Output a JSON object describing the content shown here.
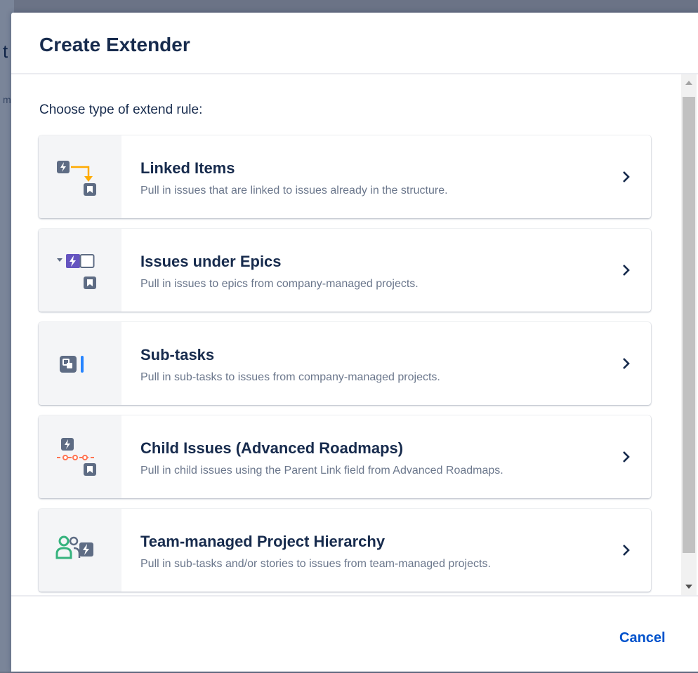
{
  "dialog": {
    "title": "Create Extender",
    "intro": "Choose type of extend rule:",
    "cancel_label": "Cancel"
  },
  "background": {
    "char_1": "t",
    "char_2": "m"
  },
  "options": [
    {
      "title": "Linked Items",
      "description": "Pull in issues that are linked to issues already in the structure.",
      "icon": "linked-items-icon"
    },
    {
      "title": "Issues under Epics",
      "description": "Pull in issues to epics from company-managed projects.",
      "icon": "epic-issues-icon"
    },
    {
      "title": "Sub-tasks",
      "description": "Pull in sub-tasks to issues from company-managed projects.",
      "icon": "subtasks-icon"
    },
    {
      "title": "Child Issues (Advanced Roadmaps)",
      "description": "Pull in child issues using the Parent Link field from Advanced Roadmaps.",
      "icon": "child-issues-icon"
    },
    {
      "title": "Team-managed Project Hierarchy",
      "description": "Pull in sub-tasks and/or stories to issues from team-managed projects.",
      "icon": "team-hierarchy-icon"
    }
  ],
  "colors": {
    "primary_text": "#172b4d",
    "secondary_text": "#6b778c",
    "link": "#0052cc",
    "icon_gray": "#5e6c84",
    "epic_purple": "#6554c0",
    "arrow_orange": "#ffab00",
    "roadmap_red": "#ff7452",
    "subtask_blue": "#2684ff",
    "team_green": "#36b37e"
  }
}
